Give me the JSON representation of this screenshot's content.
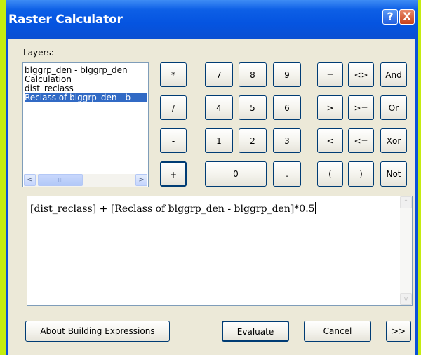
{
  "window": {
    "title": "Raster Calculator"
  },
  "titlebar": {
    "help_glyph": "?",
    "close_glyph": "X"
  },
  "layers": {
    "label": "Layers:",
    "items": [
      {
        "label": "blggrp_den - blggrp_den",
        "selected": false
      },
      {
        "label": "Calculation",
        "selected": false
      },
      {
        "label": "dist_reclass",
        "selected": false
      },
      {
        "label": "Reclass of blggrp_den - b",
        "selected": true
      }
    ],
    "scroll_left": "<",
    "scroll_thumb": "III",
    "scroll_right": ">"
  },
  "operators": {
    "multiply": "*",
    "divide": "/",
    "minus": "-",
    "plus": "+",
    "equal": "=",
    "not_equal": "<>",
    "greater": ">",
    "greater_equal": ">=",
    "less": "<",
    "less_equal": "<=",
    "open_paren": "(",
    "close_paren": ")",
    "and": "And",
    "or": "Or",
    "xor": "Xor",
    "not": "Not",
    "decimal": "."
  },
  "digits": {
    "d7": "7",
    "d8": "8",
    "d9": "9",
    "d4": "4",
    "d5": "5",
    "d6": "6",
    "d1": "1",
    "d2": "2",
    "d3": "3",
    "d0": "0"
  },
  "expression": {
    "text": "[dist_reclass] + [Reclass of blggrp_den - blggrp_den]*0.5"
  },
  "expr_scroll": {
    "up": "^",
    "down": "v"
  },
  "bottom": {
    "about_label": "About Building Expressions",
    "evaluate_label": "Evaluate",
    "cancel_label": "Cancel",
    "more_label": ">>"
  },
  "colors": {
    "title_bar": "#0554e0",
    "selection": "#316ac5",
    "outer_bg": "#c5ed10",
    "dialog_bg": "#ece9d8"
  }
}
